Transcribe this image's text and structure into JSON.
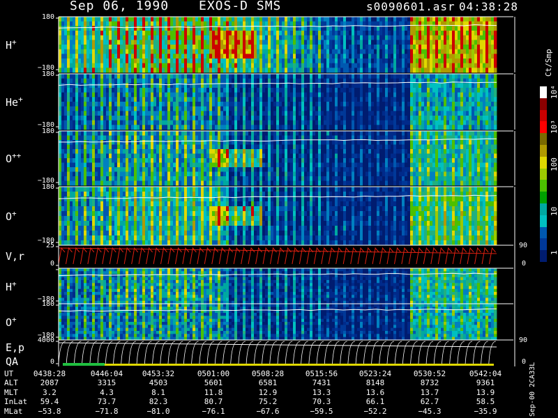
{
  "header": {
    "date": "Sep 06, 1990",
    "mission": "EXOS-D SMS",
    "filename": "s0090601.asr",
    "time": "04:38:28"
  },
  "colorbar": {
    "unit": "Ct/Smp",
    "labels": [
      "10⁴",
      "10³",
      "100",
      "10",
      "1"
    ],
    "colors": [
      "#ffffff",
      "#8b0000",
      "#cc0000",
      "#ff0000",
      "#7a6a00",
      "#b09a00",
      "#e0d800",
      "#9cc800",
      "#4cc000",
      "#00a000",
      "#00a8a0",
      "#00c0c0",
      "#0058b0",
      "#003898",
      "#001c70"
    ]
  },
  "side_text": "Sep-00 2CA33L",
  "panels": [
    {
      "label": "H",
      "sup": "+",
      "top_tick": "180",
      "bottom_tick": "−180",
      "intensity": 0.75
    },
    {
      "label": "He",
      "sup": "+",
      "top_tick": "180",
      "bottom_tick": "−180",
      "intensity": 0.35
    },
    {
      "label": "O",
      "sup": "++",
      "top_tick": "180",
      "bottom_tick": "−180",
      "intensity": 0.45
    },
    {
      "label": "O",
      "sup": "+",
      "top_tick": "180",
      "bottom_tick": "−180",
      "intensity": 0.55
    },
    {
      "label": "V,r",
      "sup": "",
      "top_tick": "25",
      "bottom_tick": "0",
      "right_top": "90",
      "right_bottom": "0",
      "intensity": 0
    },
    {
      "label": "H",
      "sup": "+",
      "top_tick": "",
      "bottom_tick": "−180",
      "intensity": 0.45
    },
    {
      "label": "O",
      "sup": "+",
      "top_tick": "180",
      "bottom_tick": "−180",
      "intensity": 0.4
    },
    {
      "label": "E,p",
      "sup": "",
      "label2": "QA",
      "top_tick": "4000",
      "bottom_tick": "0",
      "right_top": "90",
      "right_bottom": "0",
      "intensity": 0
    }
  ],
  "chart_data": {
    "type": "heatmap",
    "title": "Sep 06, 1990   EXOS-D SMS",
    "ylim_angle": [
      -180,
      180
    ],
    "colorbar_label": "Ct/Smp",
    "colorbar_ticks": [
      "10⁴",
      "10³",
      "100",
      "10",
      "1"
    ],
    "series": [
      {
        "name": "H⁺"
      },
      {
        "name": "He⁺"
      },
      {
        "name": "O⁺⁺"
      },
      {
        "name": "O⁺"
      },
      {
        "name": "V,r"
      },
      {
        "name": "H⁺"
      },
      {
        "name": "O⁺"
      },
      {
        "name": "E,p"
      }
    ],
    "table": {
      "row_labels": [
        "UT",
        "ALT",
        "MLT",
        "InLat",
        "MLat"
      ],
      "rows": [
        [
          "0438:28",
          "0446:04",
          "0453:32",
          "0501:00",
          "0508:28",
          "0515:56",
          "0523:24",
          "0530:52",
          "0542:04"
        ],
        [
          "2087",
          "3315",
          "4503",
          "5601",
          "6581",
          "7431",
          "8148",
          "8732",
          "9361"
        ],
        [
          "3.2",
          "4.3",
          "8.1",
          "11.8",
          "12.9",
          "13.3",
          "13.6",
          "13.7",
          "13.9"
        ],
        [
          "59.4",
          "73.7",
          "82.3",
          "80.7",
          "75.2",
          "70.3",
          "66.1",
          "62.7",
          "58.5"
        ],
        [
          "−53.8",
          "−71.8",
          "−81.0",
          "−76.1",
          "−67.6",
          "−59.5",
          "−52.2",
          "−45.3",
          "−35.9"
        ]
      ]
    }
  }
}
